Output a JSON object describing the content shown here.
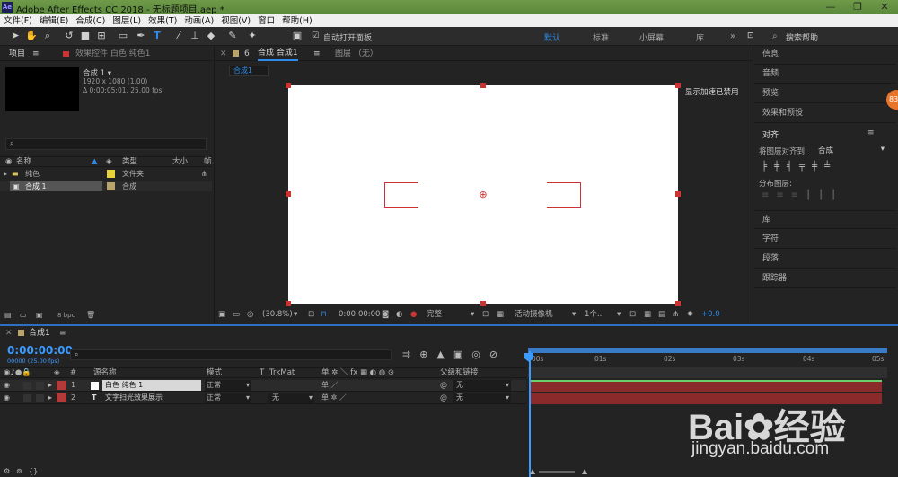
{
  "window": {
    "app_title": "Adobe After Effects CC 2018 - 无标题项目.aep *",
    "min": "—",
    "max": "❐",
    "close": "✕",
    "logo": "Ae"
  },
  "menu": [
    "文件(F)",
    "编辑(E)",
    "合成(C)",
    "图层(L)",
    "效果(T)",
    "动画(A)",
    "视图(V)",
    "窗口",
    "帮助(H)"
  ],
  "toolbar": {
    "snap_label": "自动打开面板",
    "workspaces": [
      "默认",
      "标准",
      "小屏幕",
      "库"
    ],
    "search_placeholder": "搜索帮助",
    "icons": [
      "selection-icon",
      "hand-icon",
      "zoom-icon",
      "rotate-icon",
      "camera-icon",
      "pan-behind-icon",
      "rectangle-icon",
      "pen-icon",
      "type-icon",
      "brush-icon",
      "clone-stamp-icon",
      "eraser-icon",
      "roto-brush-icon",
      "puppet-pin-icon"
    ]
  },
  "project": {
    "tab_label": "项目",
    "effects_tab": "效果控件 白色 纯色1",
    "comp_name": "合成 1 ▾",
    "comp_res": "1920 x 1080 (1.00)",
    "comp_duration": "Δ 0:00:05:01, 25.00 fps",
    "search_placeholder": "",
    "columns": [
      "名称",
      "类型",
      "大小",
      "帧"
    ],
    "items": [
      {
        "name": "纯色",
        "type": "文件夹",
        "color": "#e8d23a"
      },
      {
        "name": "合成 1",
        "type": "合成",
        "color": "#b9a46c"
      }
    ],
    "bpc": "8 bpc"
  },
  "composition": {
    "tab_label": "合成 合成1",
    "sub_tab": "合成1",
    "layer_tab": "图层 （无）",
    "accel_notice": "显示加速已禁用",
    "zoom": "(30.8%)",
    "timecode": "0:00:00:00",
    "quality": "完整",
    "camera": "活动摄像机",
    "views": "1个...",
    "exposure": "+0.0"
  },
  "right_panel": {
    "items": [
      "信息",
      "音频",
      "预览",
      "效果和预设"
    ],
    "align_title": "对齐",
    "align_to_label": "将图层对齐到:",
    "align_to_value": "合成",
    "distribute_label": "分布图层:",
    "lower_items": [
      "库",
      "字符",
      "段落",
      "跟踪器"
    ],
    "badge": "83"
  },
  "timeline": {
    "tab_label": "合成1",
    "timecode": "0:00:00:00",
    "frame_info": "00000 (25.00 fps)",
    "columns": {
      "source": "源名称",
      "mode": "模式",
      "t": "T",
      "trkmat": "TrkMat",
      "parent": "父级和链接"
    },
    "switch_header": "单 ✲ ＼ fx ▦ ◐ ◍ ⊙",
    "ruler": [
      "00s",
      "01s",
      "02s",
      "03s",
      "04s",
      "05s"
    ],
    "layers": [
      {
        "num": "1",
        "name": "白色 纯色 1",
        "type_icon": "■",
        "mode": "正常",
        "trkmat": "",
        "parent": "无",
        "color": "#b33a3a"
      },
      {
        "num": "2",
        "name": "文字扫光效果展示",
        "type_icon": "T",
        "mode": "正常",
        "trkmat": "无",
        "parent": "无",
        "color": "#b33a3a"
      }
    ]
  },
  "watermark": {
    "brand": "Bai",
    "brand_suffix": "经验",
    "url": "jingyan.baidu.com"
  },
  "colors": {
    "accent": "#2d8ceb",
    "timecode": "#3b9bff",
    "layer_bar": "#8b2a2a",
    "handle": "#cc3333"
  }
}
